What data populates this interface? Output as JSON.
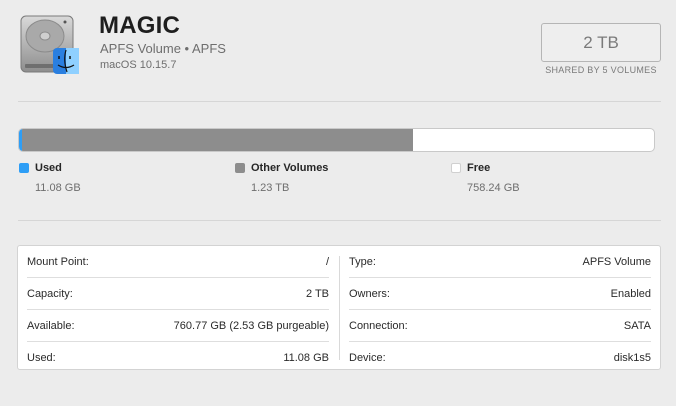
{
  "header": {
    "volume_name": "MAGIC",
    "subtitle": "APFS Volume • APFS",
    "os": "macOS 10.15.7",
    "capacity": "2 TB",
    "shared_label": "SHARED BY 5 VOLUMES",
    "icon": "hard-drive-finder-icon"
  },
  "usage": {
    "used_fraction": 0.0055,
    "other_fraction": 0.6145,
    "free_fraction": 0.38,
    "colors": {
      "used": "#2e9ef6",
      "other": "#8d8d8d",
      "free": "#ffffff"
    },
    "legend": [
      {
        "label": "Used",
        "value": "11.08 GB"
      },
      {
        "label": "Other Volumes",
        "value": "1.23 TB"
      },
      {
        "label": "Free",
        "value": "758.24 GB"
      }
    ]
  },
  "info": {
    "left": [
      {
        "key": "Mount Point:",
        "value": "/"
      },
      {
        "key": "Capacity:",
        "value": "2 TB"
      },
      {
        "key": "Available:",
        "value": "760.77 GB (2.53 GB purgeable)"
      },
      {
        "key": "Used:",
        "value": "11.08 GB"
      }
    ],
    "right": [
      {
        "key": "Type:",
        "value": "APFS Volume"
      },
      {
        "key": "Owners:",
        "value": "Enabled"
      },
      {
        "key": "Connection:",
        "value": "SATA"
      },
      {
        "key": "Device:",
        "value": "disk1s5"
      }
    ]
  }
}
